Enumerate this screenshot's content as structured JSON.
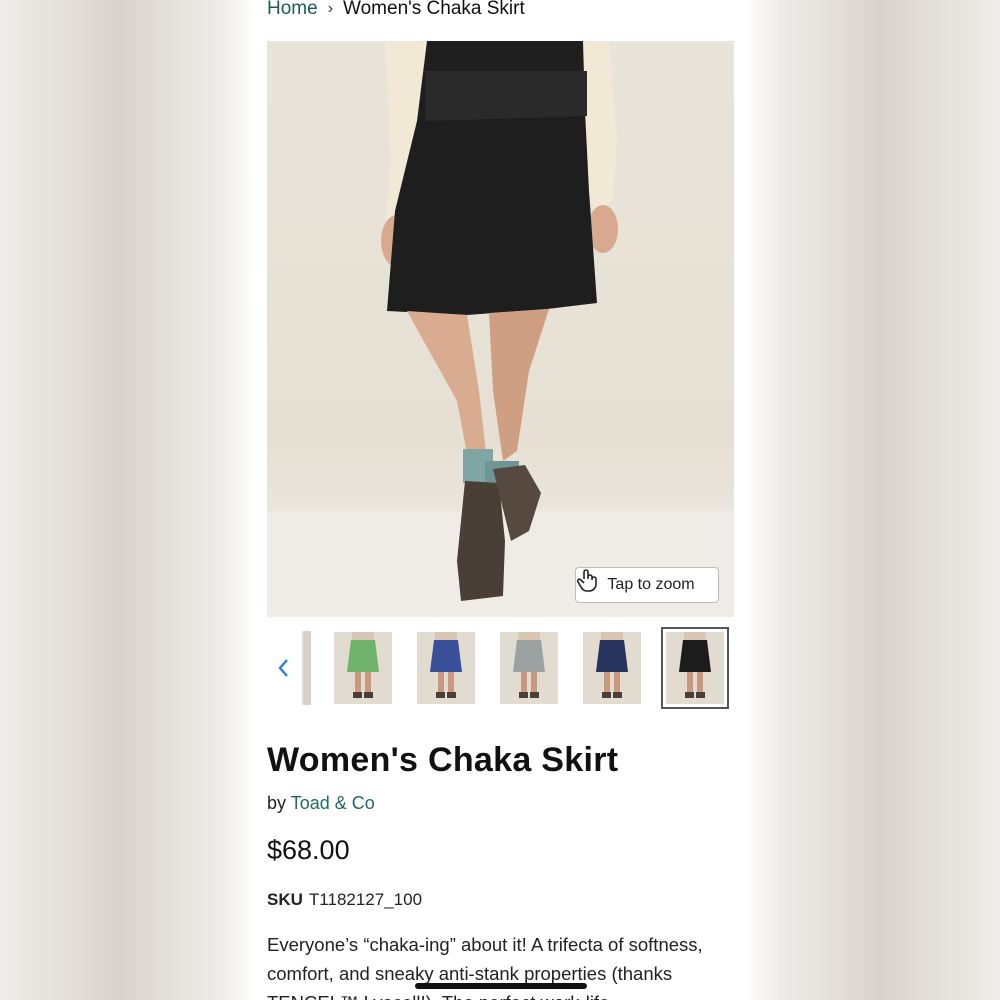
{
  "breadcrumb": {
    "home": "Home",
    "separator": "›",
    "current": "Women's Chaka Skirt"
  },
  "hero": {
    "zoom_label": "Tap to zoom",
    "zoom_icon": "tap-hand-icon"
  },
  "thumbnails": {
    "prev_icon": "chevron-left-icon",
    "items": [
      {
        "variant": "green",
        "color": "#6fb36a"
      },
      {
        "variant": "blue-print",
        "color": "#3a4f9a"
      },
      {
        "variant": "grey",
        "color": "#9aa3a1"
      },
      {
        "variant": "navy-dots",
        "color": "#27345e"
      },
      {
        "variant": "black",
        "color": "#1c1c1c"
      }
    ],
    "selected_index": 4
  },
  "product": {
    "title": "Women's Chaka Skirt",
    "by_label": "by",
    "brand": "Toad & Co",
    "price": "$68.00",
    "sku_label": "SKU",
    "sku_value": "T1182127_100",
    "description": "Everyone’s “chaka-ing” about it! A trifecta of softness, comfort, and sneaky anti-stank properties (thanks TENCEL™ Lyocell!). The perfect work-life"
  },
  "colors": {
    "link": "#1d5b54",
    "accent_blue": "#2f7fd6"
  }
}
